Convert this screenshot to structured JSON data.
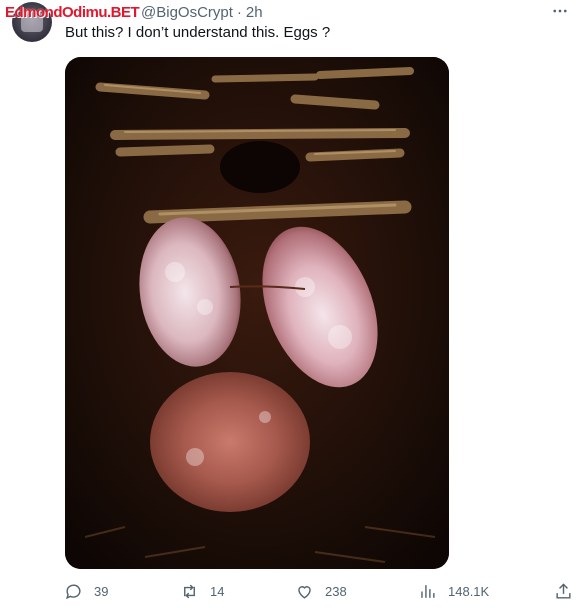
{
  "tweet": {
    "watermark": "EdmondOdimu.BET",
    "handle": "@BigOsCrypt",
    "separator": "·",
    "time": "2h",
    "text": "But this? I don’t understand this. Eggs ?",
    "more_icon": "more-icon",
    "media_description_icon": "image"
  },
  "actions": {
    "replies": "39",
    "retweets": "14",
    "likes": "238",
    "views": "148.1K"
  },
  "colors": {
    "text": "#0f1419",
    "muted": "#536471",
    "watermark": "#e0182d"
  }
}
